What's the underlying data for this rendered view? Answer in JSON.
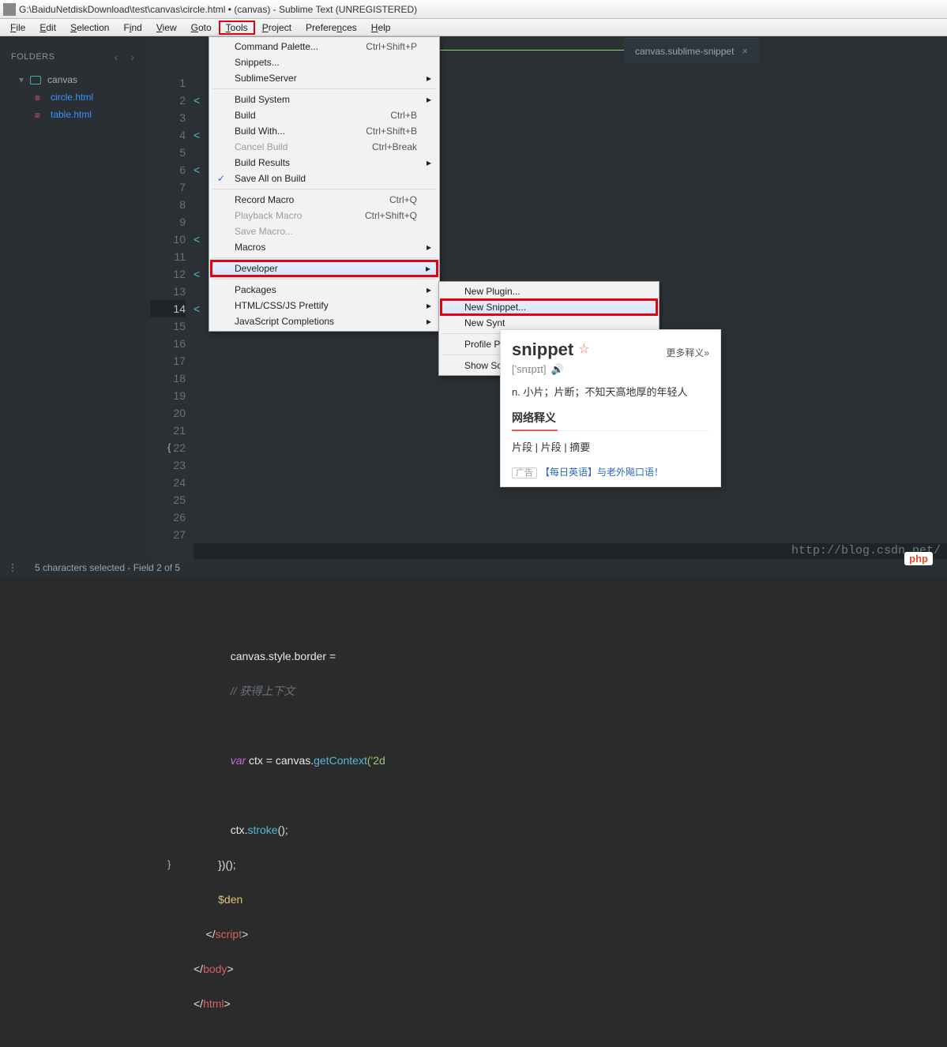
{
  "window": {
    "title": "G:\\BaiduNetdiskDownload\\test\\canvas\\circle.html • (canvas) - Sublime Text (UNREGISTERED)"
  },
  "menubar": [
    "File",
    "Edit",
    "Selection",
    "Find",
    "View",
    "Goto",
    "Tools",
    "Project",
    "Preferences",
    "Help"
  ],
  "sidebar": {
    "title": "FOLDERS",
    "folder": "canvas",
    "files": [
      "circle.html",
      "table.html"
    ]
  },
  "tabs": [
    {
      "label": "",
      "active": true
    },
    {
      "label": "canvas.sublime-snippet",
      "active": false
    }
  ],
  "gutter": [
    "1",
    "2",
    "3",
    "4",
    "5",
    "6",
    "7",
    "8",
    "9",
    "10",
    "11",
    "12",
    "13",
    "14",
    "15",
    "16",
    "17",
    "18",
    "19",
    "20",
    "21",
    "22",
    "23",
    "24",
    "25",
    "26",
    "27"
  ],
  "code": {
    "l1": "<",
    "l2": "<",
    "l3": "<",
    "l4": "",
    "l5": "<",
    "l6": "<",
    "l7": "<",
    "l11": "{",
    "l23b": "}",
    "l17_a": "canvas",
    "l17_b": ".style",
    "l17_c": ".border",
    "l17_d": " = ",
    "l18": "// 获得上下文",
    "l20_var": "var",
    "l20_id": " ctx ",
    "l20_eq": "= canvas.",
    "l20_fn": "getContext",
    "l20_str": "('2d",
    "l22_a": "ctx.",
    "l22_b": "stroke",
    "l22_c": "();",
    "l23": "})();",
    "l24": "$den",
    "l25_o": "</",
    "l25_t": "script",
    "l25_c": ">",
    "l26_o": "</",
    "l26_t": "body",
    "l26_c": ">",
    "l27_o": "</",
    "l27_t": "html",
    "l27_c": ">"
  },
  "tools_menu": [
    {
      "label": "Command Palette...",
      "short": "Ctrl+Shift+P"
    },
    {
      "label": "Snippets..."
    },
    {
      "label": "SublimeServer",
      "submenu": true
    },
    {
      "sep": true
    },
    {
      "label": "Build System",
      "submenu": true
    },
    {
      "label": "Build",
      "short": "Ctrl+B"
    },
    {
      "label": "Build With...",
      "short": "Ctrl+Shift+B"
    },
    {
      "label": "Cancel Build",
      "short": "Ctrl+Break",
      "disabled": true
    },
    {
      "label": "Build Results",
      "submenu": true
    },
    {
      "label": "Save All on Build",
      "checked": true
    },
    {
      "sep": true
    },
    {
      "label": "Record Macro",
      "short": "Ctrl+Q"
    },
    {
      "label": "Playback Macro",
      "short": "Ctrl+Shift+Q",
      "disabled": true
    },
    {
      "label": "Save Macro...",
      "disabled": true
    },
    {
      "label": "Macros",
      "submenu": true
    },
    {
      "sep": true
    },
    {
      "label": "Developer",
      "submenu": true,
      "boxed": true,
      "hover": true
    },
    {
      "sep": true
    },
    {
      "label": "Packages",
      "submenu": true
    },
    {
      "label": "HTML/CSS/JS Prettify",
      "submenu": true
    },
    {
      "label": "JavaScript Completions",
      "submenu": true
    }
  ],
  "dev_submenu": [
    {
      "label": "New Plugin..."
    },
    {
      "label": "New Snippet...",
      "boxed": true,
      "hover": true
    },
    {
      "label": "New Synt"
    },
    {
      "sep": true
    },
    {
      "label": "Profile Pl"
    },
    {
      "sep": true
    },
    {
      "label": "Show Sco"
    }
  ],
  "dict": {
    "word": "snippet",
    "more": "更多释义»",
    "phon": "['snɪpɪt]",
    "def": "n. 小片；片断；不知天高地厚的年轻人",
    "sect": "网络释义",
    "trans": "片段 | 片段 | 摘要",
    "ad_tag": "广告",
    "ad_link": "【每日英语】与老外飚口语！"
  },
  "status": {
    "left": "5 characters selected - Field 2 of 5"
  },
  "footer_url": "http://blog.csdn.net/",
  "logo": "php"
}
